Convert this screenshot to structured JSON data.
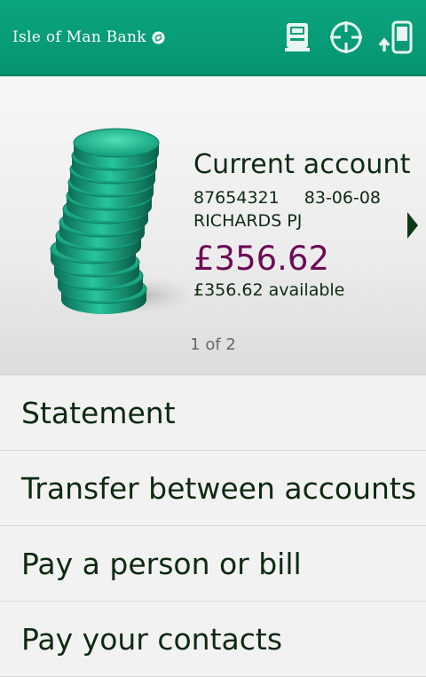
{
  "app_bar": {
    "brand": "Isle of Man Bank",
    "brand_icon": "bank-logo-mark-icon",
    "actions": [
      {
        "icon": "atm-icon"
      },
      {
        "icon": "locator-crosshair-icon"
      },
      {
        "icon": "phone-upload-icon"
      }
    ]
  },
  "account_card": {
    "title": "Current account",
    "account_number": "87654321",
    "sort_code": "83-06-08",
    "holder": "RICHARDS PJ",
    "balance": "£356.62",
    "available": "£356.62 available",
    "pager": "1 of 2",
    "image": "coin-stack-image",
    "next_icon": "chevron-right-icon"
  },
  "menu": {
    "items": [
      {
        "label": "Statement"
      },
      {
        "label": "Transfer between accounts"
      },
      {
        "label": "Pay a person or bill"
      },
      {
        "label": "Pay your contacts"
      }
    ]
  },
  "colors": {
    "header": "#08a078",
    "balance": "#6b0b56",
    "text": "#0f2a12"
  }
}
